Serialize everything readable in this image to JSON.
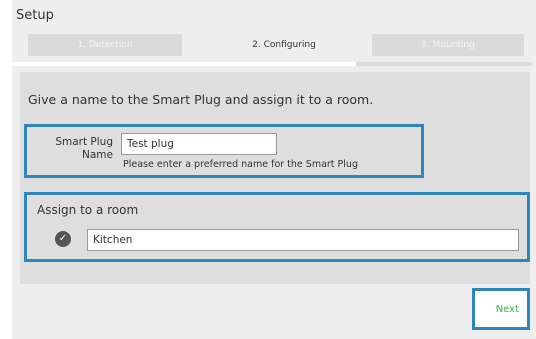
{
  "window": {
    "title": "Setup"
  },
  "steps": [
    {
      "label": "1. Detection",
      "state": "inactive"
    },
    {
      "label": "2. Configuring",
      "state": "active"
    },
    {
      "label": "3. Mounting",
      "state": "inactive"
    }
  ],
  "instructions": "Give a name to the Smart Plug and assign it to a room.",
  "name_section": {
    "label_line1": "Smart Plug",
    "label_line2": "Name",
    "value": "Test plug",
    "hint": "Please enter a preferred name for the Smart Plug"
  },
  "room_section": {
    "title": "Assign to a room",
    "value": "Kitchen",
    "icon": "check-circle-icon"
  },
  "actions": {
    "next_label": "Next"
  },
  "colors": {
    "highlight_border": "#2f86b8",
    "next_text": "#3bb34a",
    "panel_bg": "#eeeeee",
    "form_bg": "#dedede"
  }
}
